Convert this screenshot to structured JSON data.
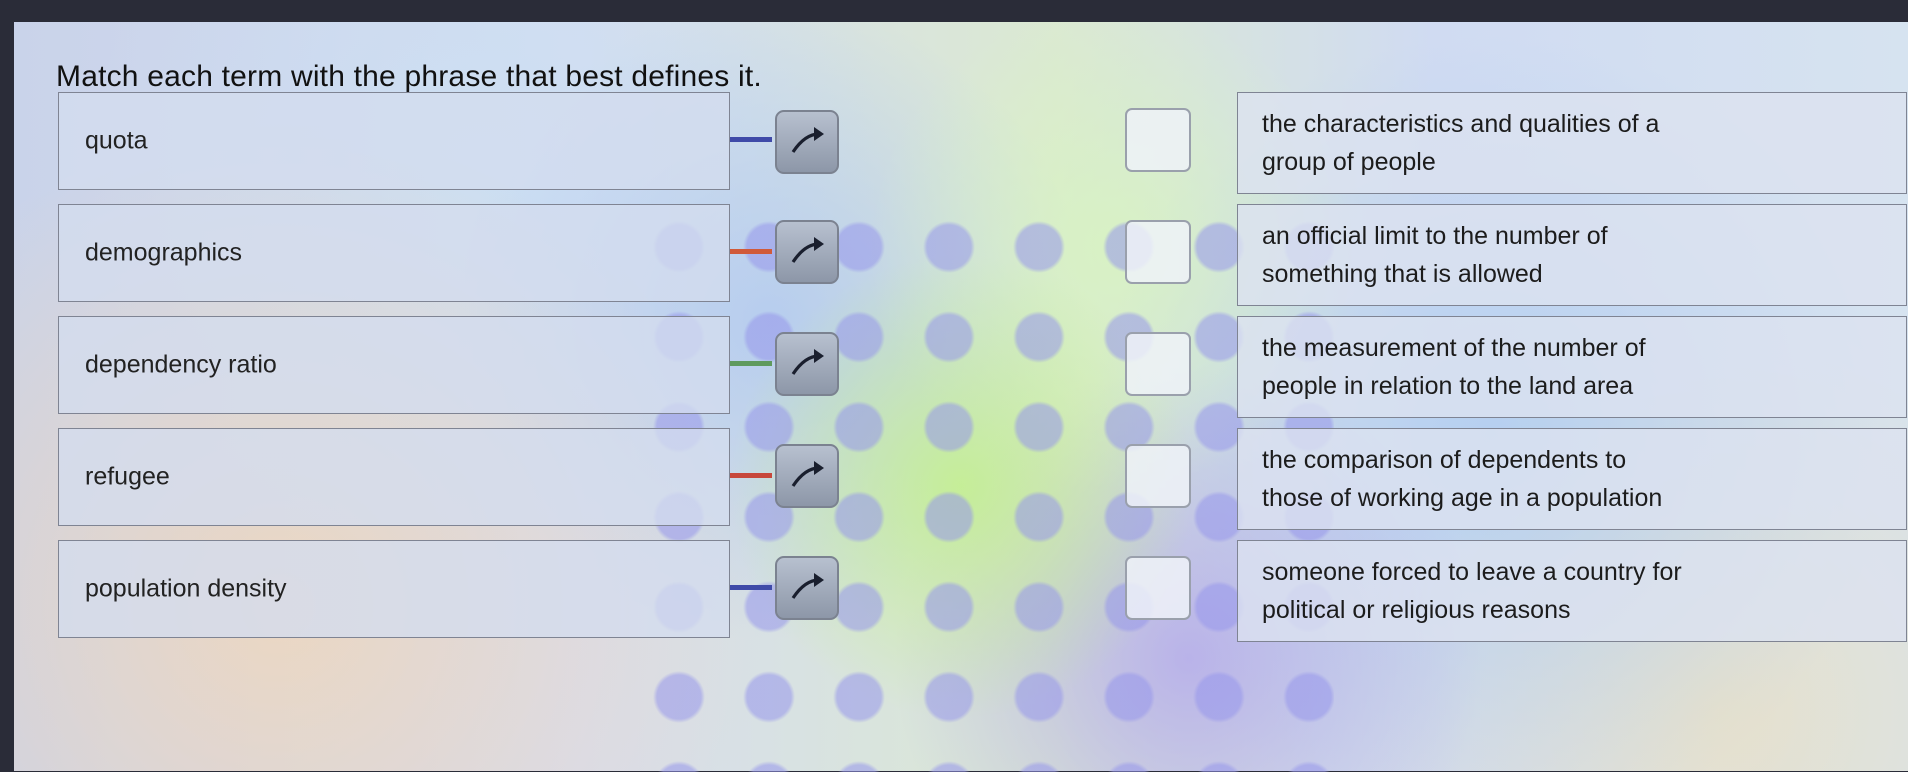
{
  "instructions": "Match each term with the phrase that best defines it.",
  "terms": [
    {
      "label": "quota",
      "connector_color": "#3f4aa8"
    },
    {
      "label": "demographics",
      "connector_color": "#d05a3a"
    },
    {
      "label": "dependency ratio",
      "connector_color": "#5f9a5e"
    },
    {
      "label": "refugee",
      "connector_color": "#c7473b"
    },
    {
      "label": "population density",
      "connector_color": "#3f4aa8"
    }
  ],
  "definitions": [
    {
      "line1": "the characteristics and qualities of a",
      "line2": "group of people"
    },
    {
      "line1": "an official limit to the number of",
      "line2": "something that is allowed"
    },
    {
      "line1": "the measurement of the number of",
      "line2": "people in relation to the land area"
    },
    {
      "line1": "the comparison of dependents to",
      "line2": "those of working age in a population"
    },
    {
      "line1": "someone forced to leave a country for",
      "line2": "political or religious reasons"
    }
  ],
  "icons": {
    "handle": "arrow-icon"
  }
}
